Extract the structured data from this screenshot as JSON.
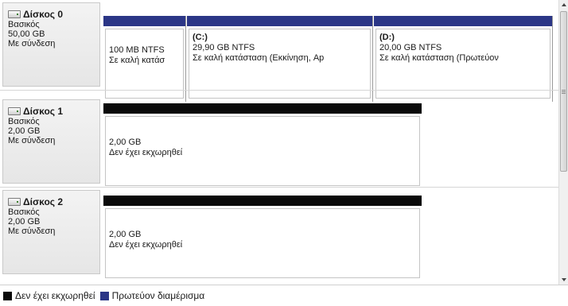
{
  "colors": {
    "primary_partition": "#2b3686",
    "unallocated": "#0a0a0a"
  },
  "disks": [
    {
      "name": "Δίσκος 0",
      "type": "Βασικός",
      "size": "50,00 GB",
      "status": "Με σύνδεση",
      "partitions": [
        {
          "kind": "primary",
          "volume": "",
          "size": "100 MB NTFS",
          "status": "Σε καλή κατάσ"
        },
        {
          "kind": "primary",
          "volume": "(C:)",
          "size": "29,90 GB NTFS",
          "status": "Σε καλή κατάσταση (Εκκίνηση, Ap"
        },
        {
          "kind": "primary",
          "volume": "(D:)",
          "size": "20,00 GB NTFS",
          "status": "Σε καλή κατάσταση (Πρωτεύον"
        }
      ]
    },
    {
      "name": "Δίσκος 1",
      "type": "Βασικός",
      "size": "2,00 GB",
      "status": "Με σύνδεση",
      "partitions": [
        {
          "kind": "unallocated",
          "size": "2,00 GB",
          "status": "Δεν έχει εκχωρηθεί"
        }
      ]
    },
    {
      "name": "Δίσκος 2",
      "type": "Βασικός",
      "size": "2,00 GB",
      "status": "Με σύνδεση",
      "partitions": [
        {
          "kind": "unallocated",
          "size": "2,00 GB",
          "status": "Δεν έχει εκχωρηθεί"
        }
      ]
    }
  ],
  "legend": {
    "unallocated_label": "Δεν έχει εκχωρηθεί",
    "primary_label": "Πρωτεύον διαμέρισμα"
  },
  "icons": {
    "disk": "disk-drive-icon",
    "scroll_up": "scroll-up-arrow-icon",
    "scroll_down": "scroll-down-arrow-icon"
  }
}
